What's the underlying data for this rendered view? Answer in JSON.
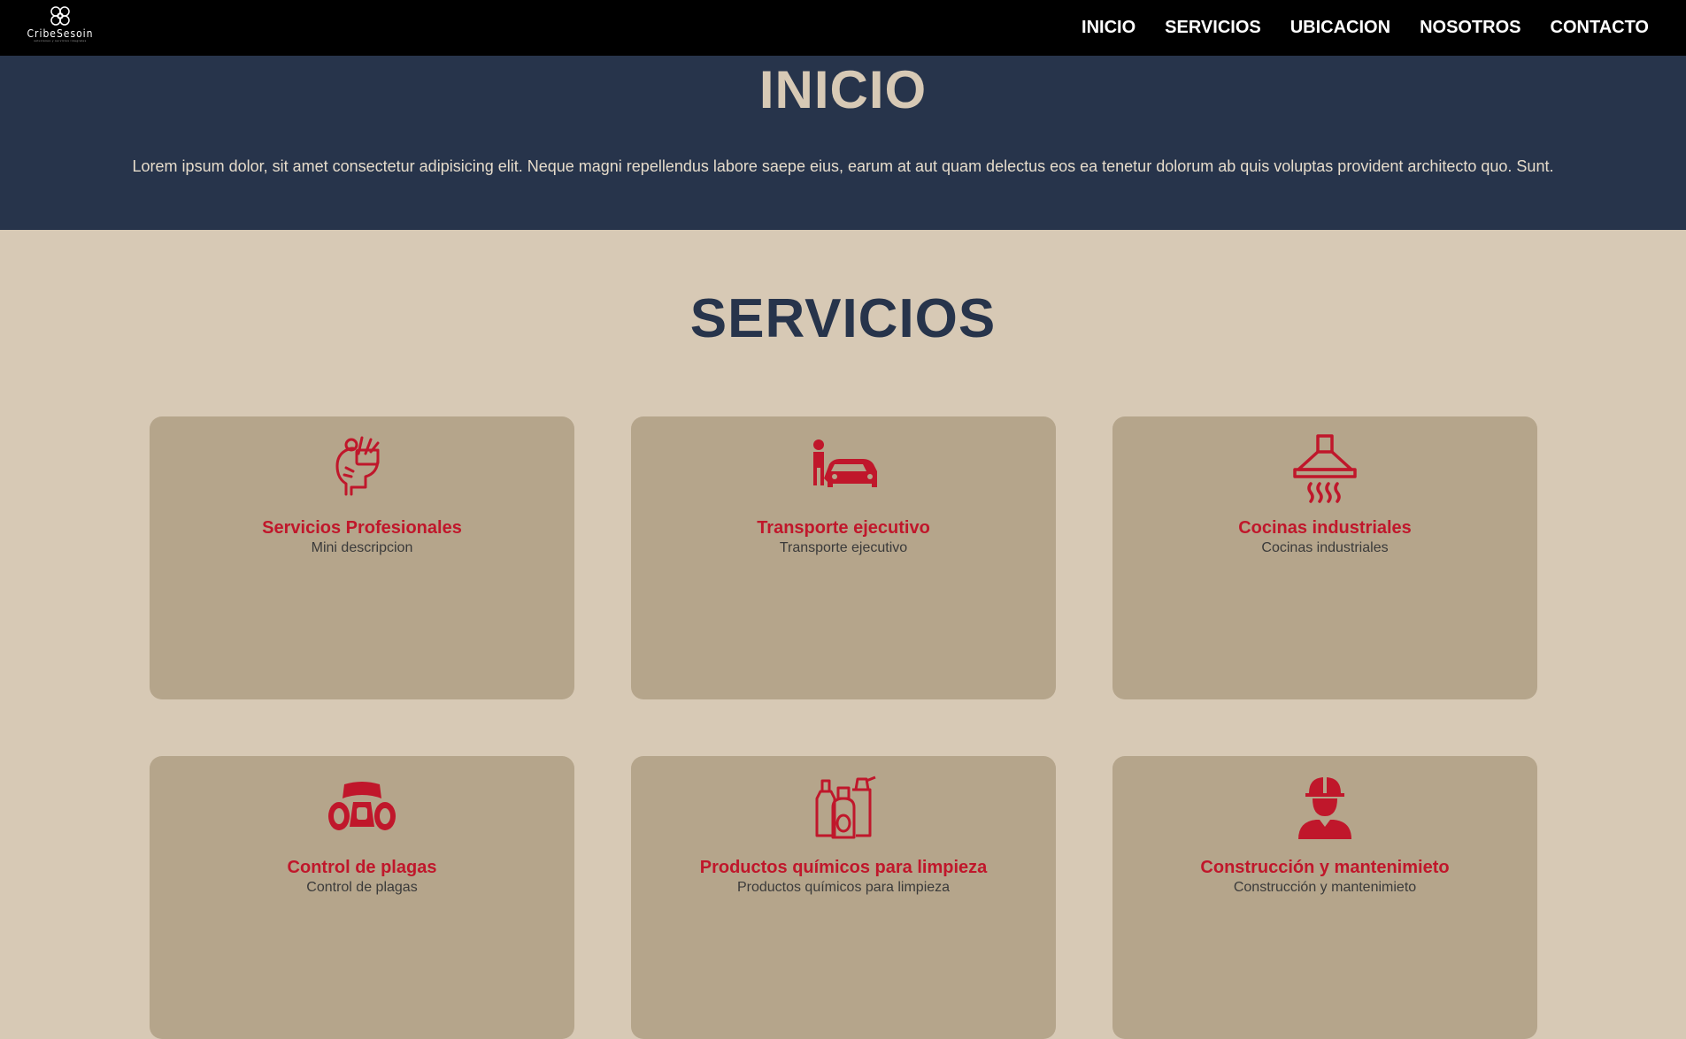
{
  "brand": {
    "name": "CribeSesoin",
    "tagline": "soluciones y servicios integrales",
    "icon": "brain-logo-icon"
  },
  "nav": {
    "items": [
      {
        "label": "INICIO"
      },
      {
        "label": "SERVICIOS"
      },
      {
        "label": "UBICACION"
      },
      {
        "label": "NOSOTROS"
      },
      {
        "label": "CONTACTO"
      }
    ]
  },
  "hero": {
    "title": "INICIO",
    "text": "Lorem ipsum dolor, sit amet consectetur adipisicing elit. Neque magni repellendus labore saepe eius, earum at aut quam delectus eos ea tenetur dolorum ab quis voluptas provident architecto quo. Sunt."
  },
  "services": {
    "title": "SERVICIOS",
    "cards": [
      {
        "title": "Servicios Profesionales",
        "desc": "Mini descripcion",
        "icon": "head-ideas-icon"
      },
      {
        "title": "Transporte ejecutivo",
        "desc": "Transporte ejecutivo",
        "icon": "executive-car-icon"
      },
      {
        "title": "Cocinas industriales",
        "desc": "Cocinas industriales",
        "icon": "kitchen-hood-icon"
      },
      {
        "title": "Control de plagas",
        "desc": "Control de plagas",
        "icon": "gas-mask-icon"
      },
      {
        "title": "Productos químicos para limpieza",
        "desc": "Productos químicos para limpieza",
        "icon": "cleaning-bottles-icon"
      },
      {
        "title": "Construcción y mantenimieto",
        "desc": "Construcción y mantenimieto",
        "icon": "construction-worker-icon"
      }
    ]
  },
  "colors": {
    "nav_bg": "#000000",
    "hero_bg": "#27344b",
    "page_bg": "#d7c9b5",
    "card_bg": "#b5a58b",
    "accent_red": "#c0172b"
  }
}
